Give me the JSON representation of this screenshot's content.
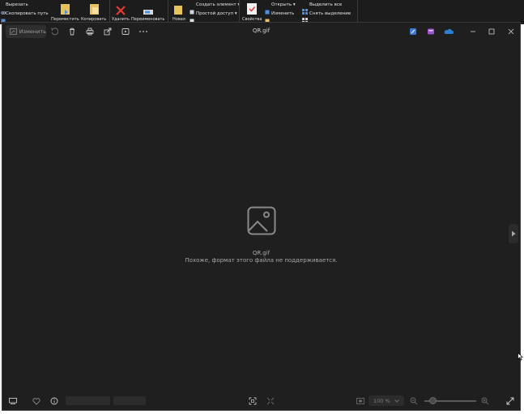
{
  "ribbon": {
    "cut_label": "Вырезать",
    "copy_path_label": "Скопировать путь",
    "move_label": "Переместить",
    "copy_label": "Копировать",
    "delete_label": "Удалить",
    "rename_label": "Переименовать",
    "new_label": "Новая",
    "create_item_label": "Создать элемент",
    "easy_access_label": "Простой доступ",
    "properties_label": "Свойства",
    "open_label": "Открыть",
    "edit_label": "Изменить",
    "select_all_label": "Выделить все",
    "deselect_label": "Снять выделение"
  },
  "viewer": {
    "edit_button": "Изменить",
    "title": "QR.gif",
    "file_name": "QR.gif",
    "message": "Похоже, формат этого файла не поддерживается.",
    "zoom": "100 %"
  },
  "colors": {
    "background": "#1f1f1f",
    "text_muted": "#a8a8a8",
    "accent_blue": "#4a8fe0",
    "accent_purple": "#a05cd6",
    "onedrive": "#2a7fd4"
  }
}
